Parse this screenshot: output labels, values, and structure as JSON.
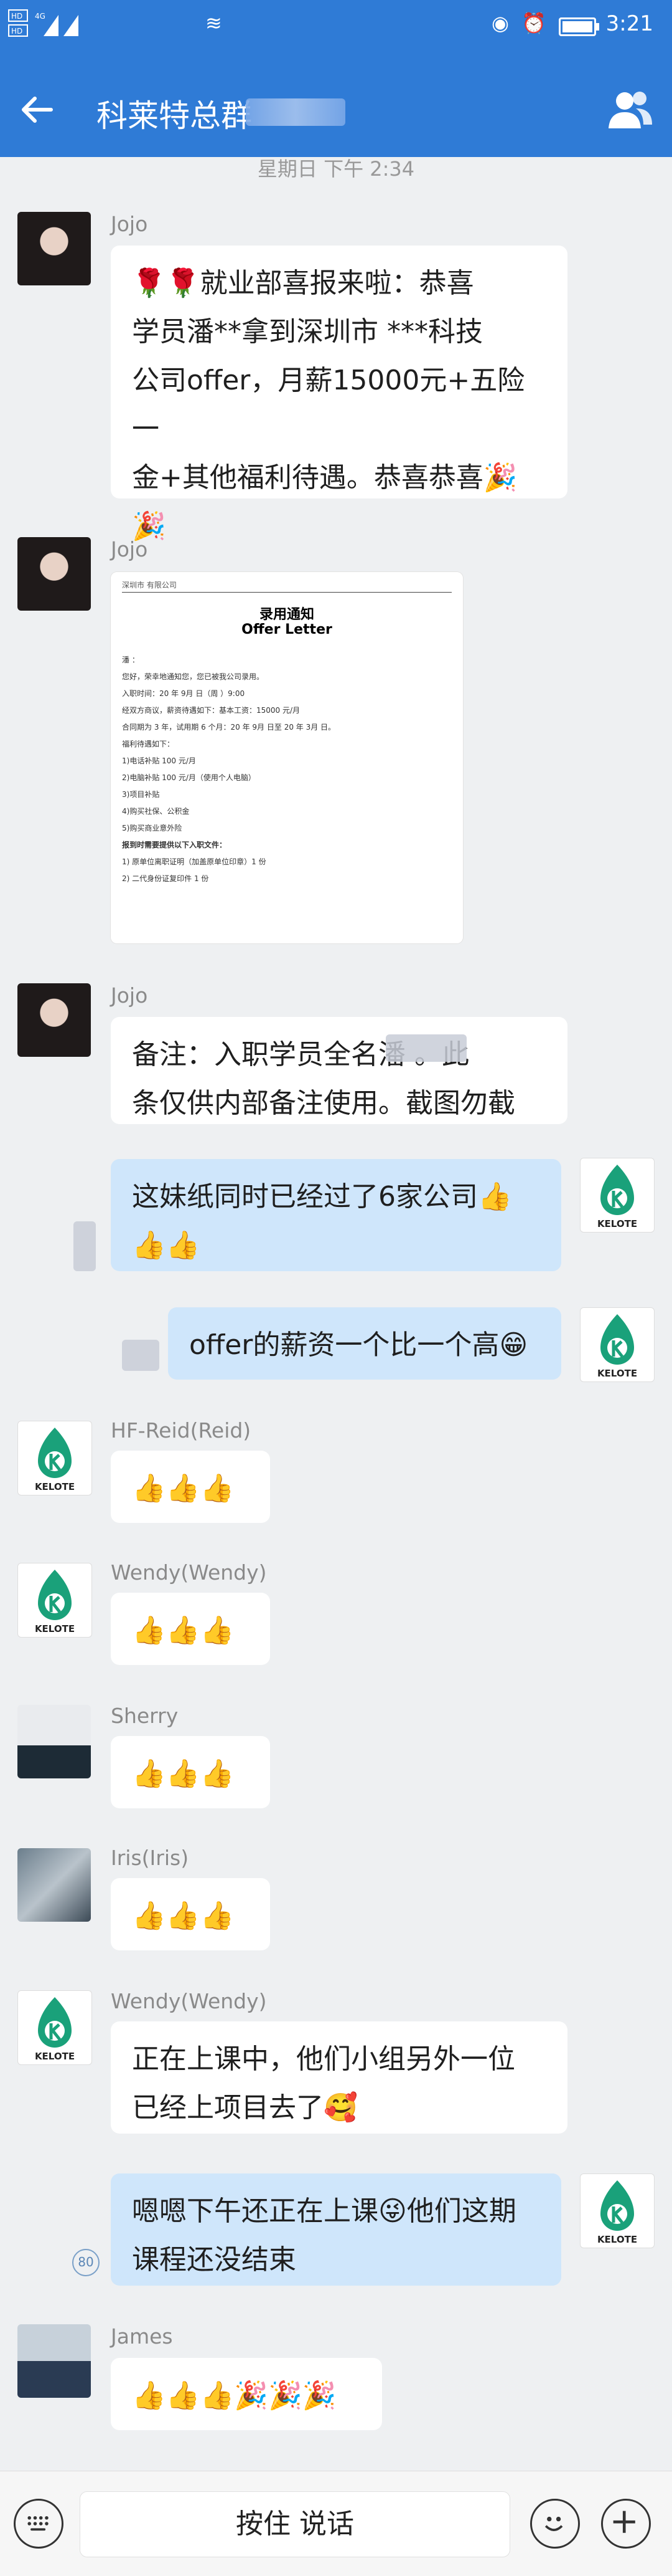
{
  "status_bar": {
    "time": "3:21",
    "network": "4G"
  },
  "header": {
    "title": "科莱特总群"
  },
  "timestamp": "星期日 下午 2:34",
  "messages": [
    {
      "sender": "Jojo",
      "text_lines": [
        "🌹🌹就业部喜报来啦：恭喜",
        "学员潘**拿到深圳市 ***科技",
        "公司offer，月薪15000元+五险一",
        "金+其他福利待遇。恭喜恭喜🎉",
        "🎉"
      ]
    },
    {
      "sender": "Jojo",
      "image": {
        "header": "深圳市 有限公司",
        "title_cn": "录用通知",
        "title_en": "Offer Letter",
        "lines": [
          "潘 ：",
          "您好，荣幸地通知您，您已被我公司录用。",
          "入职时间：20 年 9月 日（周 ）9:00",
          "经双方商议，薪资待遇如下：基本工资：15000 元/月",
          "合同期为 3 年，试用期 6 个月：20 年 9月 日至 20 年 3月 日。",
          "福利待遇如下：",
          "1)电话补贴 100 元/月",
          "2)电脑补贴 100 元/月（使用个人电脑）",
          "3)项目补贴",
          "4)购买社保、公积金",
          "5)购买商业意外险",
          "报到时需要提供以下入职文件：",
          "1) 原单位离职证明（加盖原单位印章）1 份",
          "2) 二代身份证复印件 1 份"
        ]
      }
    },
    {
      "sender": "Jojo",
      "text_lines": [
        "备注：入职学员全名潘 。此",
        "条仅供内部备注使用。截图勿截"
      ]
    },
    {
      "side": "right",
      "text_lines": [
        "这妹纸同时已经过了6家公司👍",
        "👍👍"
      ]
    },
    {
      "side": "right",
      "text_lines": [
        "offer的薪资一个比一个高😁"
      ]
    },
    {
      "sender": "HF-Reid(Reid)",
      "emoji": "👍👍👍"
    },
    {
      "sender": "Wendy(Wendy)",
      "emoji": "👍👍👍"
    },
    {
      "sender": "Sherry",
      "emoji": "👍👍👍"
    },
    {
      "sender": "Iris(Iris)",
      "emoji": "👍👍👍"
    },
    {
      "sender": "Wendy(Wendy)",
      "text_lines": [
        "正在上课中，他们小组另外一位",
        "已经上项目去了🥰"
      ]
    },
    {
      "side": "right",
      "text_lines": [
        "嗯嗯下午还正在上课😜他们这期",
        "课程还没结束"
      ],
      "badge": "80"
    },
    {
      "sender": "James",
      "emoji": "👍👍👍🎉🎉🎉"
    }
  ],
  "logo_text": "KELOTE",
  "composer": {
    "voice_label": "按住 说话"
  },
  "colors": {
    "header_bg": "#2f7bd6",
    "bubble_right": "#cfe6fb",
    "bubble_left": "#ffffff"
  }
}
